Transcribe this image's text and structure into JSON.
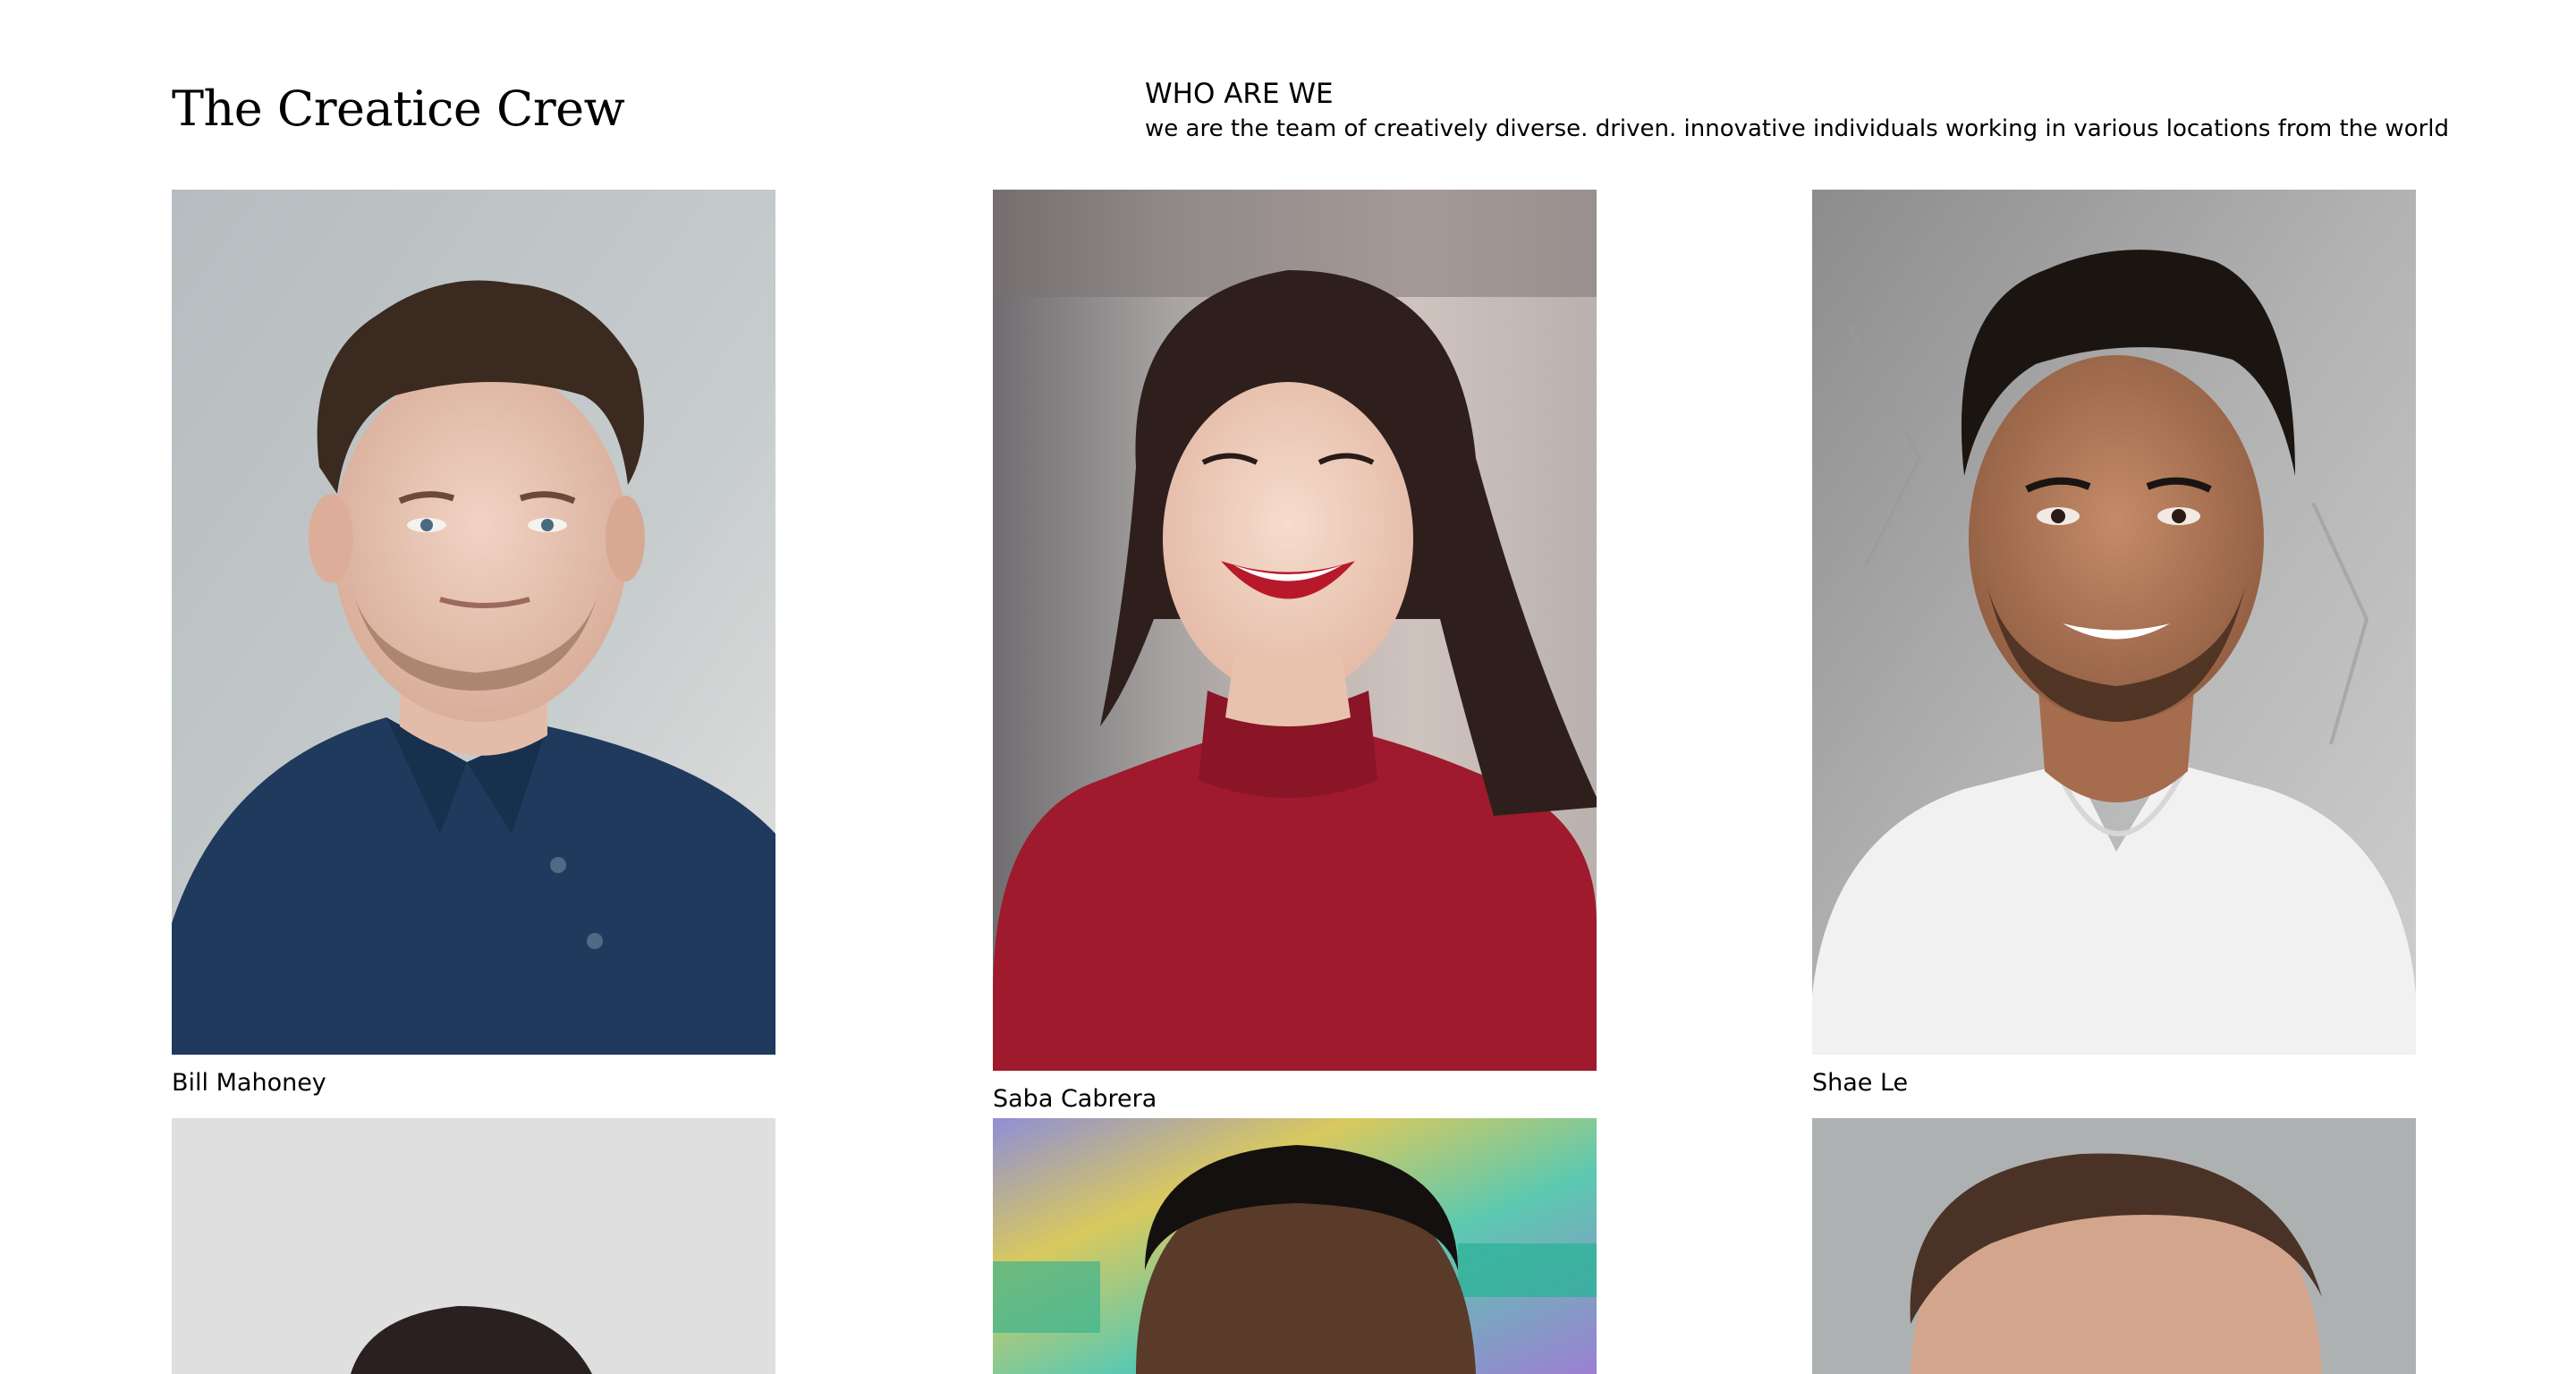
{
  "header": {
    "title": "The Creatice Crew",
    "about_heading": "WHO ARE WE",
    "about_text": "we are the team of creatively diverse. driven. innovative individuals working in various locations from the world"
  },
  "team": [
    {
      "name": "Bill Mahoney"
    },
    {
      "name": "Saba Cabrera"
    },
    {
      "name": "Shae Le"
    },
    {
      "name": ""
    },
    {
      "name": ""
    },
    {
      "name": ""
    }
  ]
}
